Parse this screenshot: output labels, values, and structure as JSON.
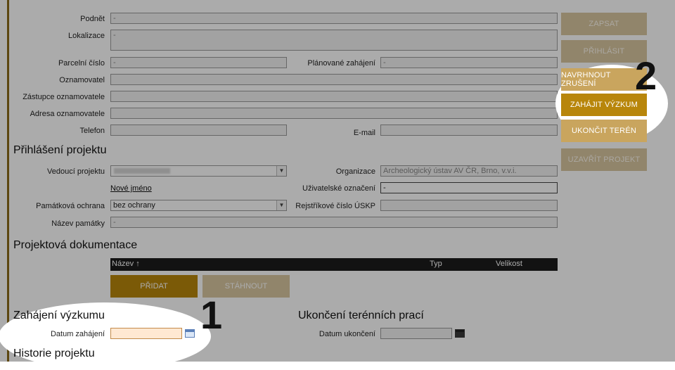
{
  "form": {
    "podnet": {
      "label": "Podnět",
      "value": "-"
    },
    "lokalizace": {
      "label": "Lokalizace",
      "value": "-"
    },
    "parcelni_cislo": {
      "label": "Parcelní číslo",
      "value": "-"
    },
    "planovane_zahajeni": {
      "label": "Plánované zahájení",
      "value": "-"
    },
    "oznamovatel": {
      "label": "Oznamovatel",
      "value": ""
    },
    "zastupce": {
      "label": "Zástupce oznamovatele",
      "value": ""
    },
    "adresa": {
      "label": "Adresa oznamovatele",
      "value": ""
    },
    "telefon": {
      "label": "Telefon",
      "value": ""
    },
    "email": {
      "label": "E-mail",
      "value": ""
    }
  },
  "prihlaseni": {
    "title": "Přihlášení projektu",
    "vedouci": {
      "label": "Vedoucí projektu",
      "value": ""
    },
    "organizace": {
      "label": "Organizace",
      "value": "Archeologický ústav AV ČR, Brno, v.v.i."
    },
    "nove_jmeno": "Nové jméno",
    "uzivatelske": {
      "label": "Uživatelské označení",
      "value": "-"
    },
    "pamatkova": {
      "label": "Památková ochrana",
      "value": "bez ochrany"
    },
    "rejstrikove": {
      "label": "Rejstříkové číslo ÚSKP",
      "value": ""
    },
    "nazev_pamatky": {
      "label": "Název památky",
      "value": "-"
    }
  },
  "dokumentace": {
    "title": "Projektová dokumentace",
    "columns": {
      "nazev": "Název ↑",
      "typ": "Typ",
      "velikost": "Velikost"
    },
    "pridat": "PŘIDAT",
    "stahnout": "STÁHNOUT"
  },
  "zahajeni": {
    "title": "Zahájení výzkumu",
    "label": "Datum zahájení",
    "value": ""
  },
  "ukonceni": {
    "title": "Ukončení terénních prací",
    "label": "Datum ukončení",
    "value": ""
  },
  "historie": {
    "title": "Historie projektu"
  },
  "actions": {
    "zapsat": "ZAPSAT",
    "prihlasit": "PŘIHLÁSIT",
    "navrhnout": "NAVRHNOUT ZRUŠENÍ",
    "zahajit": "ZAHÁJIT VÝZKUM",
    "ukoncit": "UKONČIT TERÉN",
    "uzavrit": "UZAVŘÍT PROJEKT"
  },
  "markers": {
    "one": "1",
    "two": "2"
  },
  "colors": {
    "accent": "#b8860b",
    "accent_dim": "#d8c6a0",
    "header_dark": "#1c1c1c"
  }
}
